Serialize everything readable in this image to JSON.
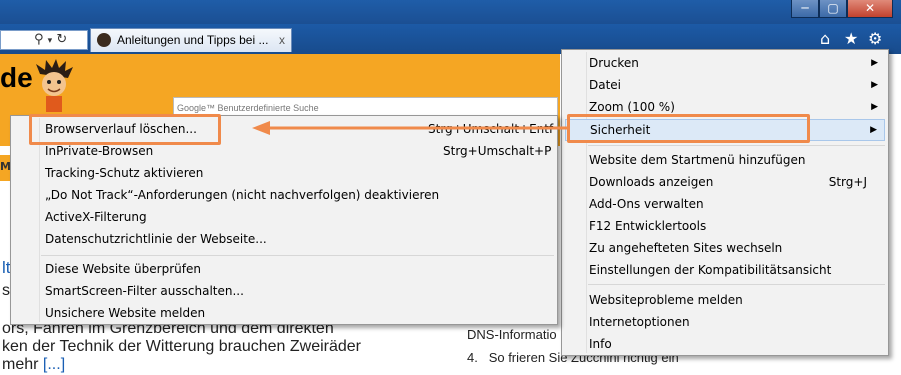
{
  "browser": {
    "tab_title": "Anleitungen und Tipps bei ...",
    "tab_close": "x",
    "window_buttons": [
      "─",
      "▢",
      "✕"
    ]
  },
  "page": {
    "logo_text": "de",
    "search_placeholder": "Google™ Benutzerdefinierte Suche",
    "nav_letter": "M",
    "article_lines": [
      "lt",
      "s",
      "ors, Fahren im Grenzbereich und dem direkten",
      "ken der Technik der Witterung brauchen Zweiräder",
      "mehr"
    ],
    "read_more": "[...]",
    "sidebar_lines": [
      "DNS-Informatio",
      "So frieren Sie Zucchini richtig ein"
    ],
    "sidebar_num": "4."
  },
  "tools_menu": {
    "items": [
      {
        "label": "Drucken",
        "submenu": true
      },
      {
        "label": "Datei",
        "submenu": true
      },
      {
        "label": "Zoom (100 %)",
        "submenu": true
      },
      {
        "label": "Sicherheit",
        "submenu": true
      },
      {
        "label": "Website dem Startmenü hinzufügen"
      },
      {
        "label": "Downloads anzeigen",
        "shortcut": "Strg+J"
      },
      {
        "label": "Add-Ons verwalten"
      },
      {
        "label": "F12 Entwicklertools"
      },
      {
        "label": "Zu angehefteten Sites wechseln"
      },
      {
        "label": "Einstellungen der Kompatibilitätsansicht"
      },
      {
        "label": "Websiteprobleme melden"
      },
      {
        "label": "Internetoptionen"
      },
      {
        "label": "Info"
      }
    ]
  },
  "security_menu": {
    "items": [
      {
        "label": "Browserverlauf löschen...",
        "shortcut": "Strg+Umschalt+Entf"
      },
      {
        "label": "InPrivate-Browsen",
        "shortcut": "Strg+Umschalt+P"
      },
      {
        "label": "Tracking-Schutz aktivieren"
      },
      {
        "label": "„Do Not Track“-Anforderungen (nicht nachverfolgen) deaktivieren"
      },
      {
        "label": "ActiveX-Filterung"
      },
      {
        "label": "Datenschutzrichtlinie der Webseite..."
      },
      {
        "label": "Diese Website überprüfen"
      },
      {
        "label": "SmartScreen-Filter ausschalten..."
      },
      {
        "label": "Unsichere Website melden"
      }
    ]
  },
  "colors": {
    "highlight": "#f08a4b",
    "chrome_blue": "#1c5aa6",
    "page_orange": "#f5a623"
  }
}
